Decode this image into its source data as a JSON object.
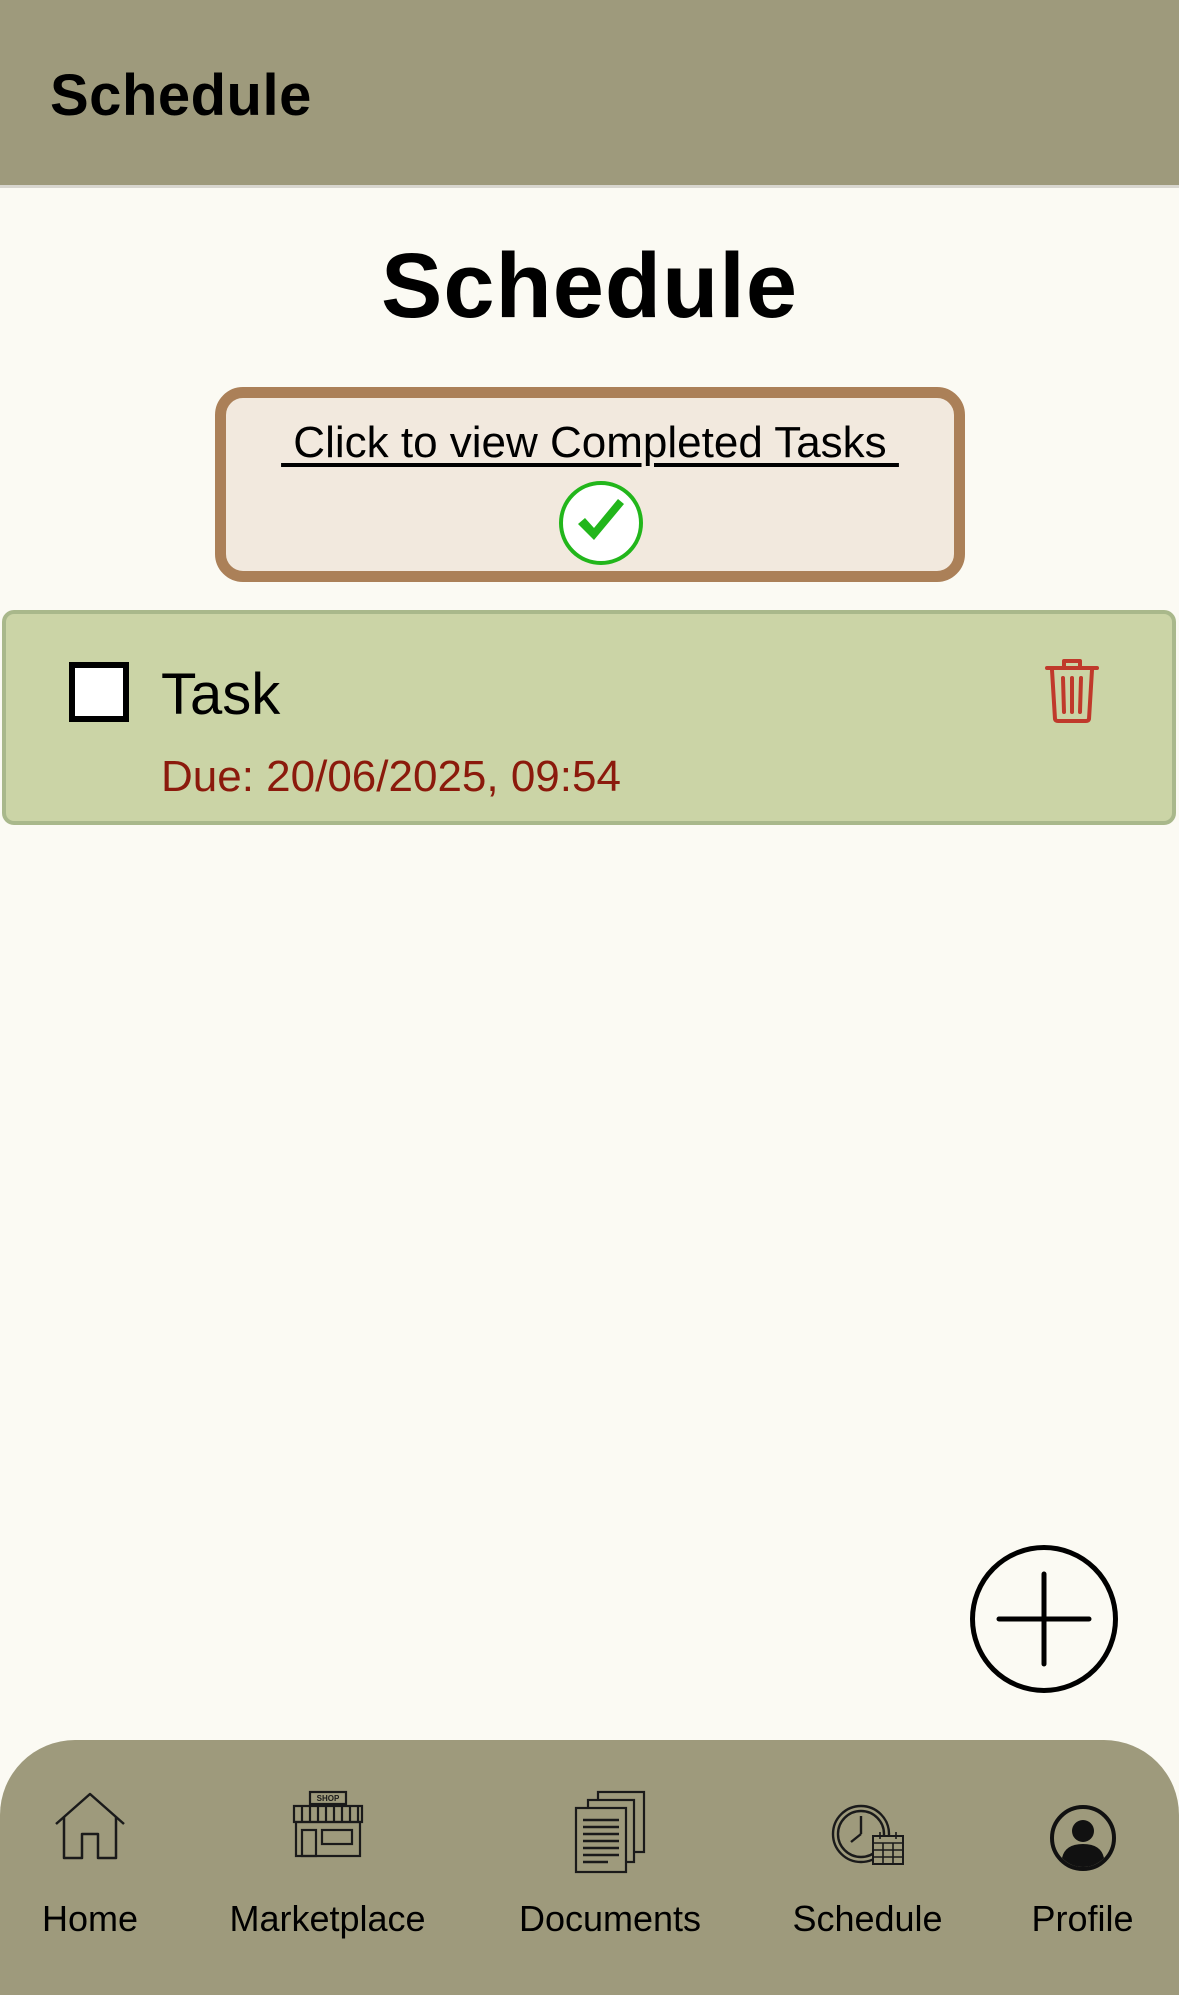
{
  "header": {
    "title": "Schedule"
  },
  "main": {
    "title": "Schedule",
    "completed_button_label": " Click to view Completed Tasks ",
    "tasks": [
      {
        "title": "Task",
        "due": "Due: 20/06/2025, 09:54",
        "completed": false
      }
    ]
  },
  "icons": {
    "completed": "check-circle-icon",
    "delete": "trash-icon",
    "add": "plus-circle-icon"
  },
  "colors": {
    "header_bg": "#9e9a7c",
    "page_bg": "#fbfaf3",
    "task_card_bg": "#cbd4a6",
    "task_card_border": "#a9b88b",
    "due_text": "#8b1a0c",
    "completed_button_bg": "#f2e9de",
    "completed_button_border": "#ab8058",
    "check_green": "#22b61b",
    "trash_red": "#c0392b"
  },
  "bottom_nav": {
    "items": [
      {
        "label": "Home",
        "icon": "home-icon"
      },
      {
        "label": "Marketplace",
        "icon": "shop-icon",
        "icon_text": "SHOP"
      },
      {
        "label": "Documents",
        "icon": "documents-icon"
      },
      {
        "label": "Schedule",
        "icon": "clock-calendar-icon"
      },
      {
        "label": "Profile",
        "icon": "profile-icon"
      }
    ]
  }
}
